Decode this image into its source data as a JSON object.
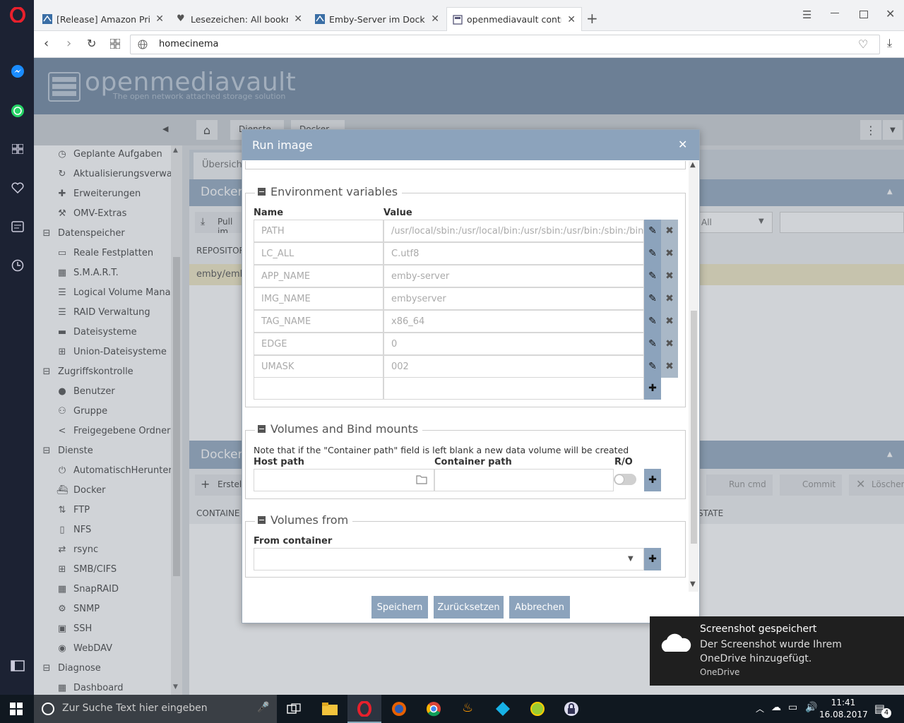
{
  "browser": {
    "tabs": [
      {
        "title": "[Release] Amazon Prime In",
        "icon": "forum-icon"
      },
      {
        "title": "Lesezeichen: All bookmarks",
        "icon": "heart-icon"
      },
      {
        "title": "Emby-Server im Docker Co",
        "icon": "forum-icon"
      },
      {
        "title": "openmediavault control pa",
        "icon": "page-icon"
      }
    ],
    "url": "homecinema"
  },
  "omv": {
    "logo_text": "openmediavault",
    "tagline": "The open network attached storage solution",
    "breadcrumb": [
      "Dienste",
      "Docker"
    ],
    "nav": [
      {
        "label": "Geplante Aufgaben",
        "icon": "clock-icon",
        "level": 2
      },
      {
        "label": "Aktualisierungsverwaltung",
        "icon": "refresh-icon",
        "level": 2
      },
      {
        "label": "Erweiterungen",
        "icon": "puzzle-icon",
        "level": 2
      },
      {
        "label": "OMV-Extras",
        "icon": "wrench-icon",
        "level": 2
      },
      {
        "label": "Datenspeicher",
        "icon": "minus-box-icon",
        "level": 1
      },
      {
        "label": "Reale Festplatten",
        "icon": "disk-icon",
        "level": 2
      },
      {
        "label": "S.M.A.R.T.",
        "icon": "chart-icon",
        "level": 2
      },
      {
        "label": "Logical Volume Management",
        "icon": "database-icon",
        "level": 2
      },
      {
        "label": "RAID Verwaltung",
        "icon": "database-icon",
        "level": 2
      },
      {
        "label": "Dateisysteme",
        "icon": "folder-icon",
        "level": 2
      },
      {
        "label": "Union-Dateisysteme",
        "icon": "sitemap-icon",
        "level": 2
      },
      {
        "label": "Zugriffskontrolle",
        "icon": "minus-box-icon",
        "level": 1
      },
      {
        "label": "Benutzer",
        "icon": "user-icon",
        "level": 2
      },
      {
        "label": "Gruppe",
        "icon": "users-icon",
        "level": 2
      },
      {
        "label": "Freigegebene Ordner",
        "icon": "share-icon",
        "level": 2
      },
      {
        "label": "Dienste",
        "icon": "minus-box-icon",
        "level": 1
      },
      {
        "label": "AutomatischHerunterfahren",
        "icon": "power-icon",
        "level": 2
      },
      {
        "label": "Docker",
        "icon": "docker-icon",
        "level": 2
      },
      {
        "label": "FTP",
        "icon": "ftp-icon",
        "level": 2
      },
      {
        "label": "NFS",
        "icon": "file-icon",
        "level": 2
      },
      {
        "label": "rsync",
        "icon": "sync-icon",
        "level": 2
      },
      {
        "label": "SMB/CIFS",
        "icon": "windows-icon",
        "level": 2
      },
      {
        "label": "SnapRAID",
        "icon": "grid-icon",
        "level": 2
      },
      {
        "label": "SNMP",
        "icon": "gear-icon",
        "level": 2
      },
      {
        "label": "SSH",
        "icon": "terminal-icon",
        "level": 2
      },
      {
        "label": "WebDAV",
        "icon": "globe-icon",
        "level": 2
      },
      {
        "label": "Diagnose",
        "icon": "minus-box-icon",
        "level": 1
      },
      {
        "label": "Dashboard",
        "icon": "dashboard-icon",
        "level": 2
      }
    ],
    "bg": {
      "tab_overview": "Übersicht",
      "panel_docker": "Docker",
      "pull_image": "Pull im",
      "col_repository": "REPOSITORY",
      "row_repo": "emby/emb",
      "filter_all": "All",
      "panel_docker2": "Docker",
      "create_btn": "Erstell",
      "col_container": "CONTAINE",
      "col_state": "STATE",
      "run_cmd": "Run cmd",
      "commit": "Commit",
      "delete": "Löschen"
    }
  },
  "modal": {
    "title": "Run image",
    "env": {
      "legend": "Environment variables",
      "col_name": "Name",
      "col_value": "Value",
      "rows": [
        {
          "name": "PATH",
          "value": "/usr/local/sbin:/usr/local/bin:/usr/sbin:/usr/bin:/sbin:/bin"
        },
        {
          "name": "LC_ALL",
          "value": "C.utf8"
        },
        {
          "name": "APP_NAME",
          "value": "emby-server"
        },
        {
          "name": "IMG_NAME",
          "value": "embyserver"
        },
        {
          "name": "TAG_NAME",
          "value": "x86_64"
        },
        {
          "name": "EDGE",
          "value": "0"
        },
        {
          "name": "UMASK",
          "value": "002"
        }
      ]
    },
    "volumes": {
      "legend": "Volumes and Bind mounts",
      "note": "Note that if the \"Container path\" field is left blank a new data volume will be created",
      "host_path": "Host path",
      "container_path": "Container path",
      "ro": "R/O"
    },
    "volumes_from": {
      "legend": "Volumes from",
      "from_container": "From container"
    },
    "buttons": {
      "save": "Speichern",
      "reset": "Zurücksetzen",
      "cancel": "Abbrechen"
    }
  },
  "toast": {
    "title": "Screenshot gespeichert",
    "body": "Der Screenshot wurde Ihrem OneDrive hinzugefügt.",
    "source": "OneDrive"
  },
  "taskbar": {
    "search_placeholder": "Zur Suche Text hier eingeben",
    "time": "11:41",
    "date": "16.08.2017",
    "notifications_count": "4"
  },
  "colors": {
    "accent": "#8ca3bc",
    "header": "#667f9a"
  }
}
